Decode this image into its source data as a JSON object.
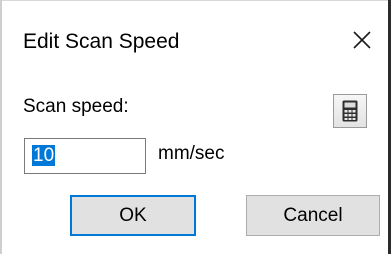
{
  "dialog": {
    "title": "Edit Scan Speed",
    "close_icon": "close-icon"
  },
  "form": {
    "scan_speed_label": "Scan speed:",
    "scan_speed_value": "10",
    "unit_label": "mm/sec",
    "calculator_icon": "calculator-icon"
  },
  "buttons": {
    "ok_label": "OK",
    "cancel_label": "Cancel"
  },
  "colors": {
    "accent": "#0078d7",
    "button_face": "#e1e1e1",
    "dialog_background": "#ffffff"
  }
}
